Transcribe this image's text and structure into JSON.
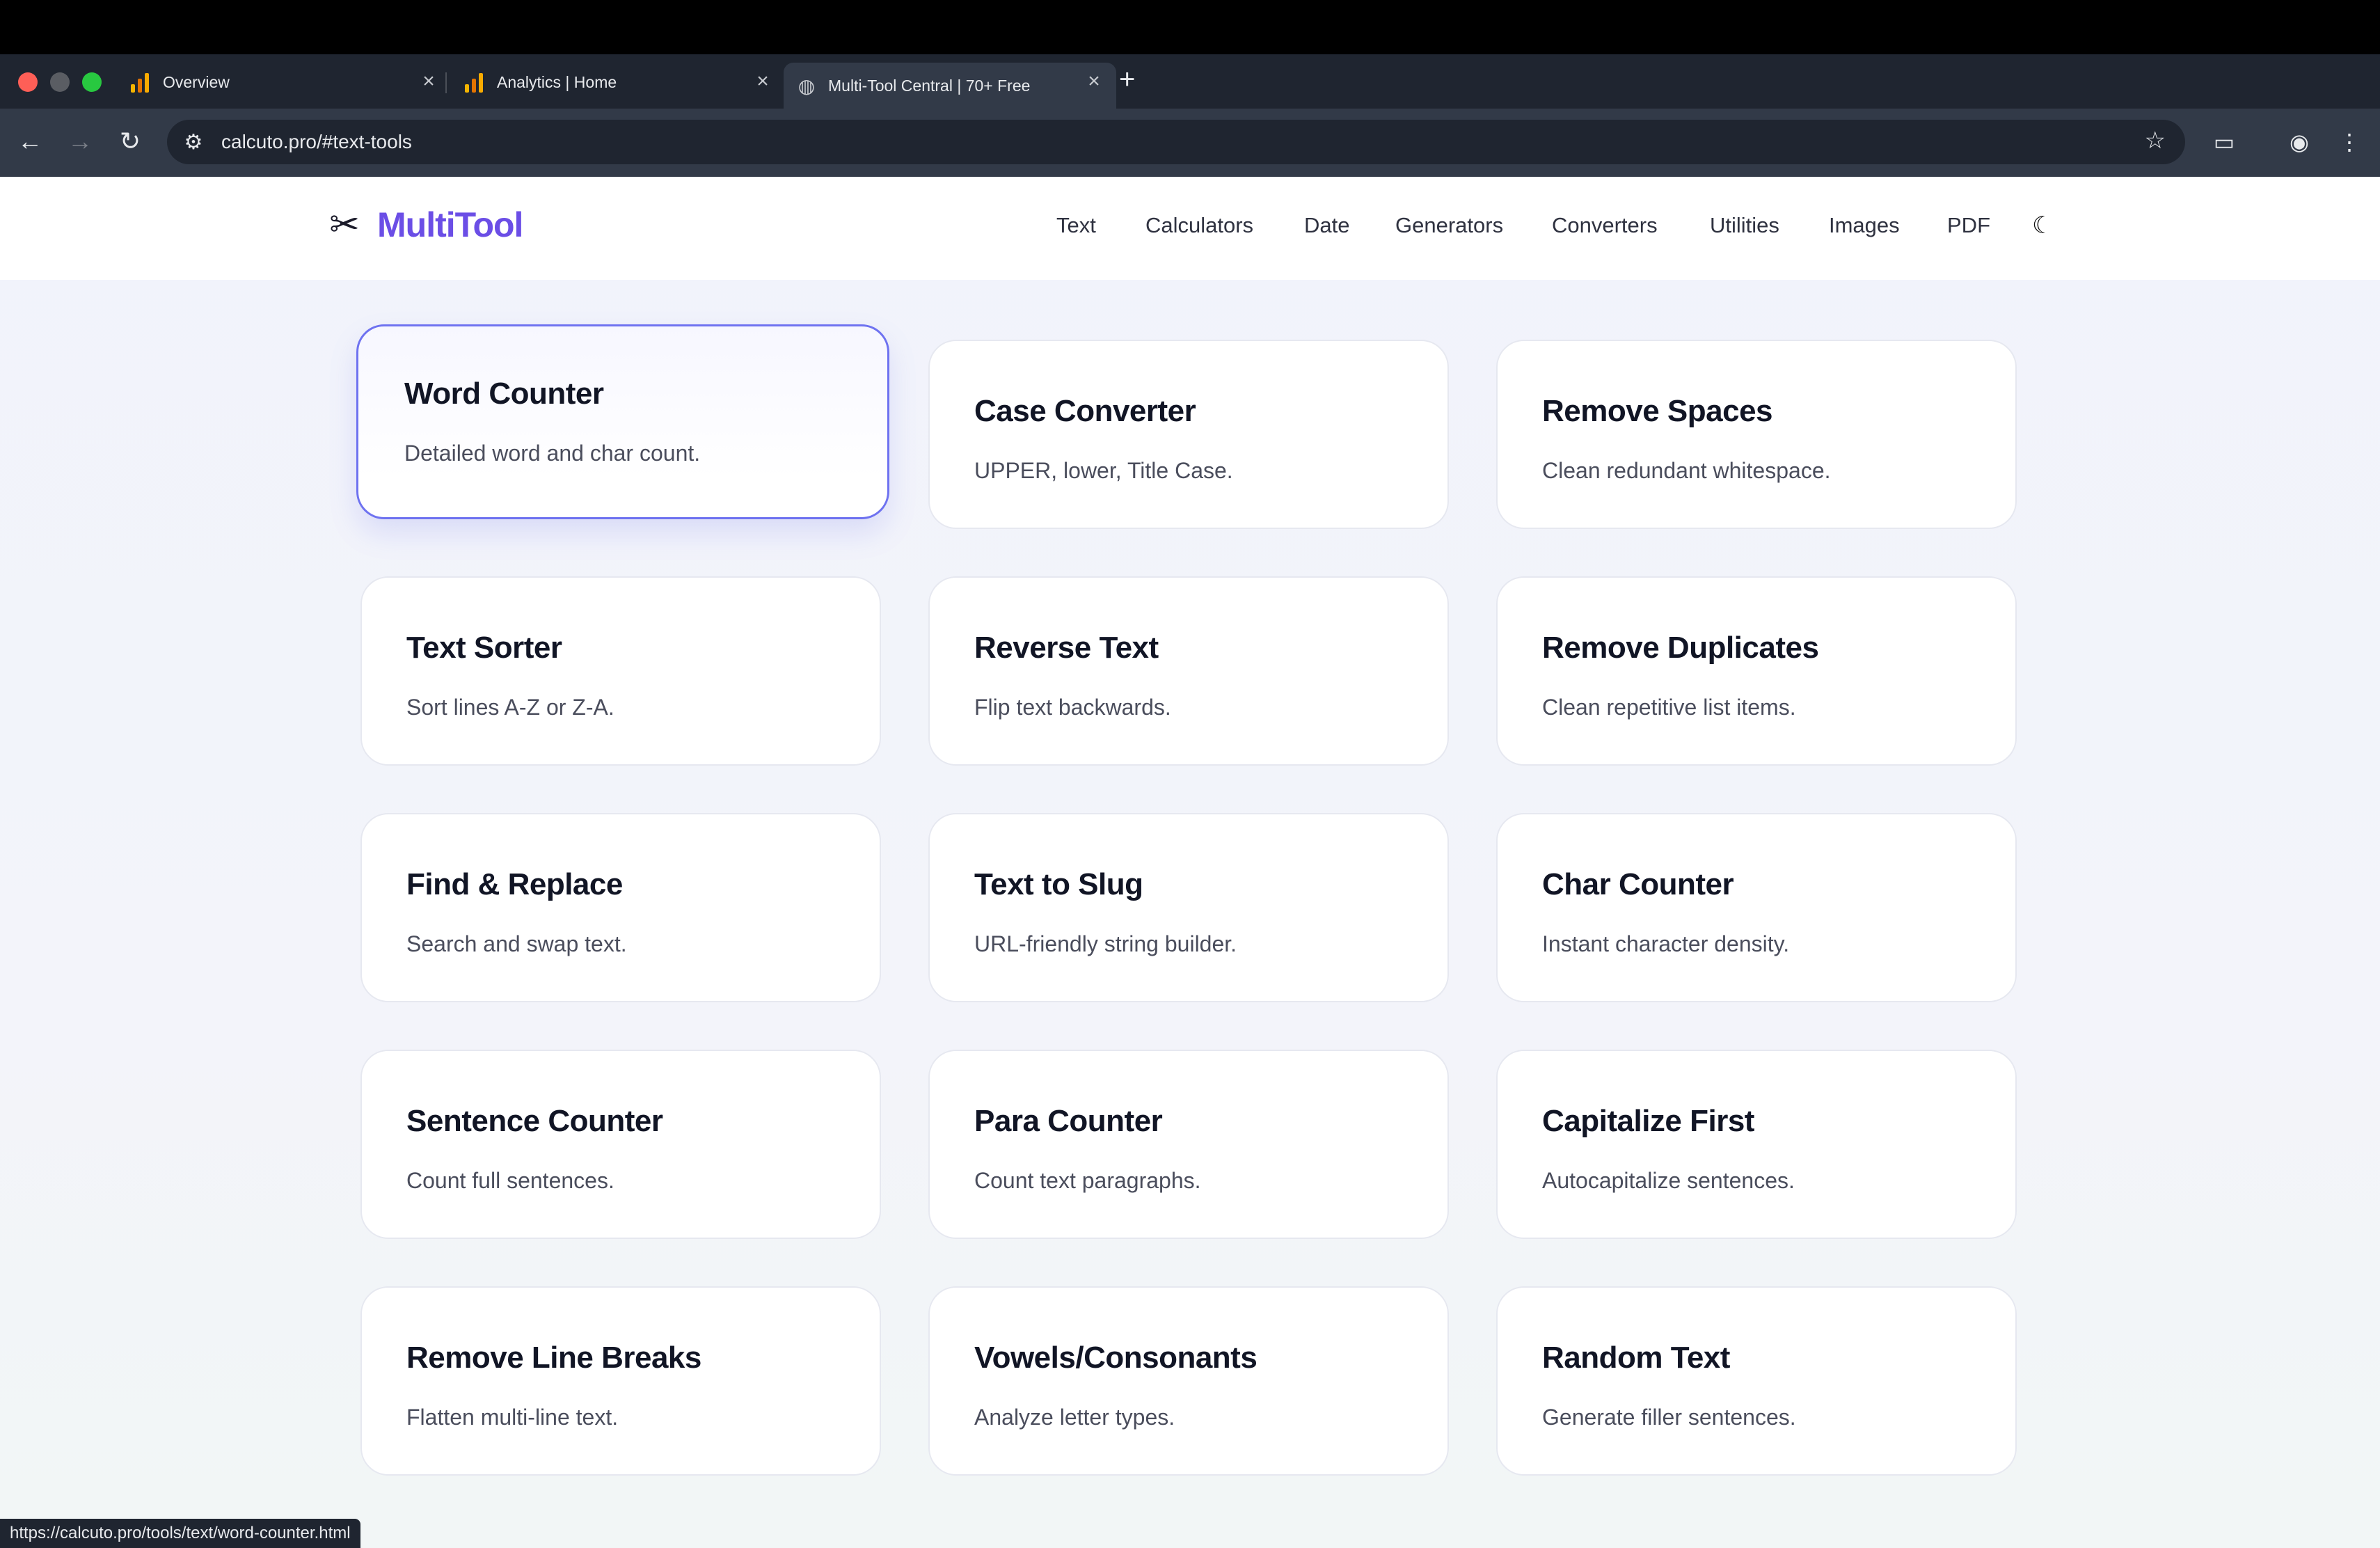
{
  "tabs": [
    {
      "title": "Overview",
      "icon": "analytics-bars-icon"
    },
    {
      "title": "Analytics | Home",
      "icon": "analytics-bars-icon"
    },
    {
      "title": "Multi-Tool Central | 70+ Free",
      "icon": "globe-icon"
    }
  ],
  "address_bar": {
    "url": "calcuto.pro/#text-tools"
  },
  "site": {
    "brand": "MultiTool",
    "nav": [
      "Text",
      "Calculators",
      "Date",
      "Generators",
      "Converters",
      "Utilities",
      "Images",
      "PDF"
    ]
  },
  "cards": [
    {
      "title": "Word Counter",
      "desc": "Detailed word and char count."
    },
    {
      "title": "Case Converter",
      "desc": "UPPER, lower, Title Case."
    },
    {
      "title": "Remove Spaces",
      "desc": "Clean redundant whitespace."
    },
    {
      "title": "Text Sorter",
      "desc": "Sort lines A-Z or Z-A."
    },
    {
      "title": "Reverse Text",
      "desc": "Flip text backwards."
    },
    {
      "title": "Remove Duplicates",
      "desc": "Clean repetitive list items."
    },
    {
      "title": "Find & Replace",
      "desc": "Search and swap text."
    },
    {
      "title": "Text to Slug",
      "desc": "URL-friendly string builder."
    },
    {
      "title": "Char Counter",
      "desc": "Instant character density."
    },
    {
      "title": "Sentence Counter",
      "desc": "Count full sentences."
    },
    {
      "title": "Para Counter",
      "desc": "Count text paragraphs."
    },
    {
      "title": "Capitalize First",
      "desc": "Autocapitalize sentences."
    },
    {
      "title": "Remove Line Breaks",
      "desc": "Flatten multi-line text."
    },
    {
      "title": "Vowels/Consonants",
      "desc": "Analyze letter types."
    },
    {
      "title": "Random Text",
      "desc": "Generate filler sentences."
    }
  ],
  "status_url": "https://calcuto.pro/tools/text/word-counter.html",
  "colors": {
    "brand": "#6b4ee6",
    "active_border": "#6e72f0"
  }
}
